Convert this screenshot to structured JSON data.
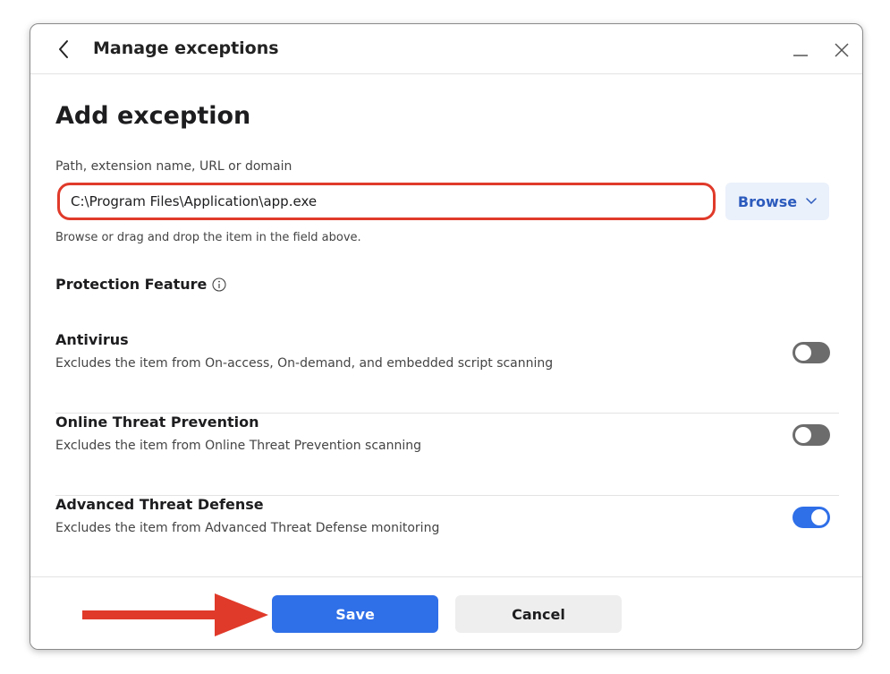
{
  "window": {
    "title": "Manage exceptions"
  },
  "form": {
    "heading": "Add exception",
    "path_label": "Path, extension name, URL or domain",
    "path_value": "C:\\Program Files\\Application\\app.exe",
    "browse_label": "Browse",
    "hint": "Browse or drag and drop the item in the field above."
  },
  "protection": {
    "section_title": "Protection Feature",
    "features": [
      {
        "title": "Antivirus",
        "description": "Excludes the item from On-access, On-demand, and embedded script scanning",
        "enabled": false
      },
      {
        "title": "Online Threat Prevention",
        "description": "Excludes the item from Online Threat Prevention scanning",
        "enabled": false
      },
      {
        "title": "Advanced Threat Defense",
        "description": "Excludes the item from Advanced Threat Defense monitoring",
        "enabled": true
      }
    ]
  },
  "footer": {
    "save_label": "Save",
    "cancel_label": "Cancel"
  },
  "colors": {
    "accent": "#2f6fe8",
    "highlight": "#e03a2a",
    "toggle_off": "#6c6c6c"
  },
  "icons": {
    "back": "chevron-left-icon",
    "minimize": "minimize-icon",
    "close": "close-icon",
    "browse_dropdown": "chevron-down-icon",
    "info": "info-icon",
    "annotation": "arrow-right-icon"
  }
}
